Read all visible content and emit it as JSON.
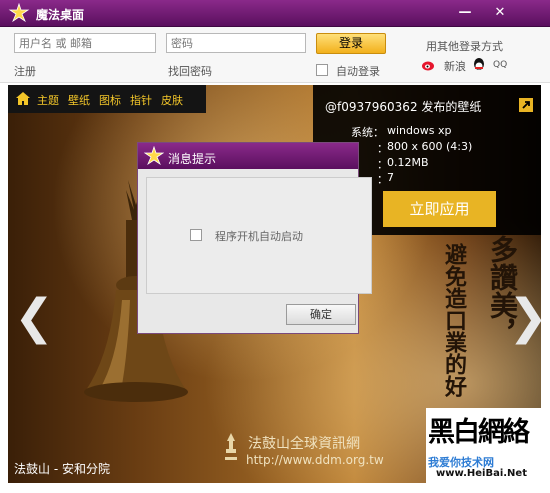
{
  "app": {
    "title": "魔法桌面"
  },
  "window": {
    "minimize": "—",
    "close": "✕"
  },
  "login": {
    "username_placeholder": "用户名 或 邮箱",
    "password_placeholder": "密码",
    "login_button": "登录",
    "register": "注册",
    "recover_password": "找回密码",
    "auto_login": "自动登录",
    "other_methods": "用其他登录方式",
    "weibo": "新浪",
    "qq": "QQ"
  },
  "nav": {
    "items": [
      "主题",
      "壁纸",
      "图标",
      "指针",
      "皮肤"
    ]
  },
  "wallpaper": {
    "publisher": "@f0937960362 发布的壁纸",
    "details": [
      {
        "label": "系统：",
        "value": "windows xp"
      },
      {
        "label": "：",
        "value": "800 x 600 (4:3)"
      },
      {
        "label": "：",
        "value": "0.12MB"
      },
      {
        "label": "：",
        "value": "7"
      }
    ],
    "apply_button": "立即应用"
  },
  "image": {
    "caption": "法鼓山 - 安和分院",
    "url": "http://www.ddm.org.tw",
    "org": "法鼓山全球資訊網",
    "calligraphy_right": "多讚美，",
    "calligraphy_left": "避免造口業的好",
    "watermark_line1": "黑白網絡",
    "watermark_line2": "我爱你技术网",
    "watermark_url": "www.HeiBai.Net"
  },
  "dialog": {
    "title": "消息提示",
    "checkbox_label": "程序开机自动启动",
    "ok": "确定"
  },
  "colors": {
    "accent_purple": "#5a0f5e",
    "gold": "#e8b424",
    "nav_text": "#f3c629"
  }
}
